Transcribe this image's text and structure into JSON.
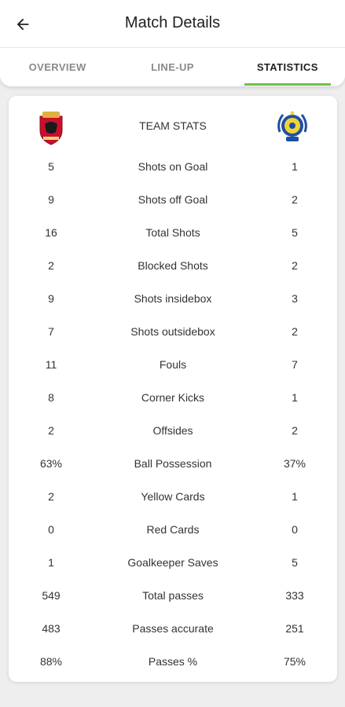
{
  "header": {
    "title": "Match Details",
    "back_icon": "arrow-back-icon"
  },
  "tabs": [
    {
      "label": "OVERVIEW",
      "active": false
    },
    {
      "label": "LINE-UP",
      "active": false
    },
    {
      "label": "STATISTICS",
      "active": true
    }
  ],
  "colors": {
    "accent": "#6cc04a",
    "home_crest": "#c8102e",
    "away_crest": "#1f4fa3"
  },
  "stats": {
    "header_label": "TEAM STATS",
    "home_logo": "home-team-crest",
    "away_logo": "away-team-crest",
    "rows": [
      {
        "home": "5",
        "name": "Shots on Goal",
        "away": "1"
      },
      {
        "home": "9",
        "name": "Shots off Goal",
        "away": "2"
      },
      {
        "home": "16",
        "name": "Total Shots",
        "away": "5"
      },
      {
        "home": "2",
        "name": "Blocked Shots",
        "away": "2"
      },
      {
        "home": "9",
        "name": "Shots insidebox",
        "away": "3"
      },
      {
        "home": "7",
        "name": "Shots outsidebox",
        "away": "2"
      },
      {
        "home": "11",
        "name": "Fouls",
        "away": "7"
      },
      {
        "home": "8",
        "name": "Corner Kicks",
        "away": "1"
      },
      {
        "home": "2",
        "name": "Offsides",
        "away": "2"
      },
      {
        "home": "63%",
        "name": "Ball Possession",
        "away": "37%"
      },
      {
        "home": "2",
        "name": "Yellow Cards",
        "away": "1"
      },
      {
        "home": "0",
        "name": "Red Cards",
        "away": "0"
      },
      {
        "home": "1",
        "name": "Goalkeeper Saves",
        "away": "5"
      },
      {
        "home": "549",
        "name": "Total passes",
        "away": "333"
      },
      {
        "home": "483",
        "name": "Passes accurate",
        "away": "251"
      },
      {
        "home": "88%",
        "name": "Passes %",
        "away": "75%"
      }
    ]
  }
}
